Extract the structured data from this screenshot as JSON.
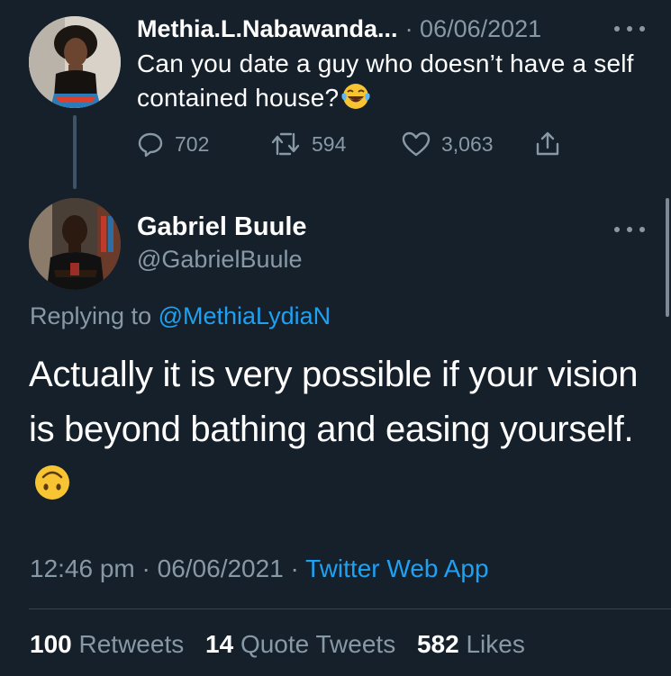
{
  "parent_tweet": {
    "display_name": "Methia.L.Nabawanda...",
    "date": "· 06/06/2021",
    "text": "Can you date a guy who doesn’t have a self contained house?",
    "emoji": "face-with-tears-of-joy",
    "reply_count": "702",
    "retweet_count": "594",
    "like_count": "3,063"
  },
  "reply_tweet": {
    "display_name": "Gabriel Buule",
    "handle": "@GabrielBuule",
    "replying_prefix": "Replying to",
    "replying_to": "@MethiaLydiaN",
    "text": "Actually it is very possible if your vision is beyond bathing and easing yourself.",
    "emoji": "upside-down-face",
    "time": "12:46 pm · 06/06/2021 ·",
    "source": "Twitter Web App",
    "retweets_value": "100",
    "retweets_label": "Retweets",
    "quotes_value": "14",
    "quotes_label": "Quote Tweets",
    "likes_value": "582",
    "likes_label": "Likes"
  },
  "colors": {
    "background": "#15202b",
    "secondary_text": "#8899a6",
    "link": "#1da1f2",
    "divider": "#38444d"
  }
}
